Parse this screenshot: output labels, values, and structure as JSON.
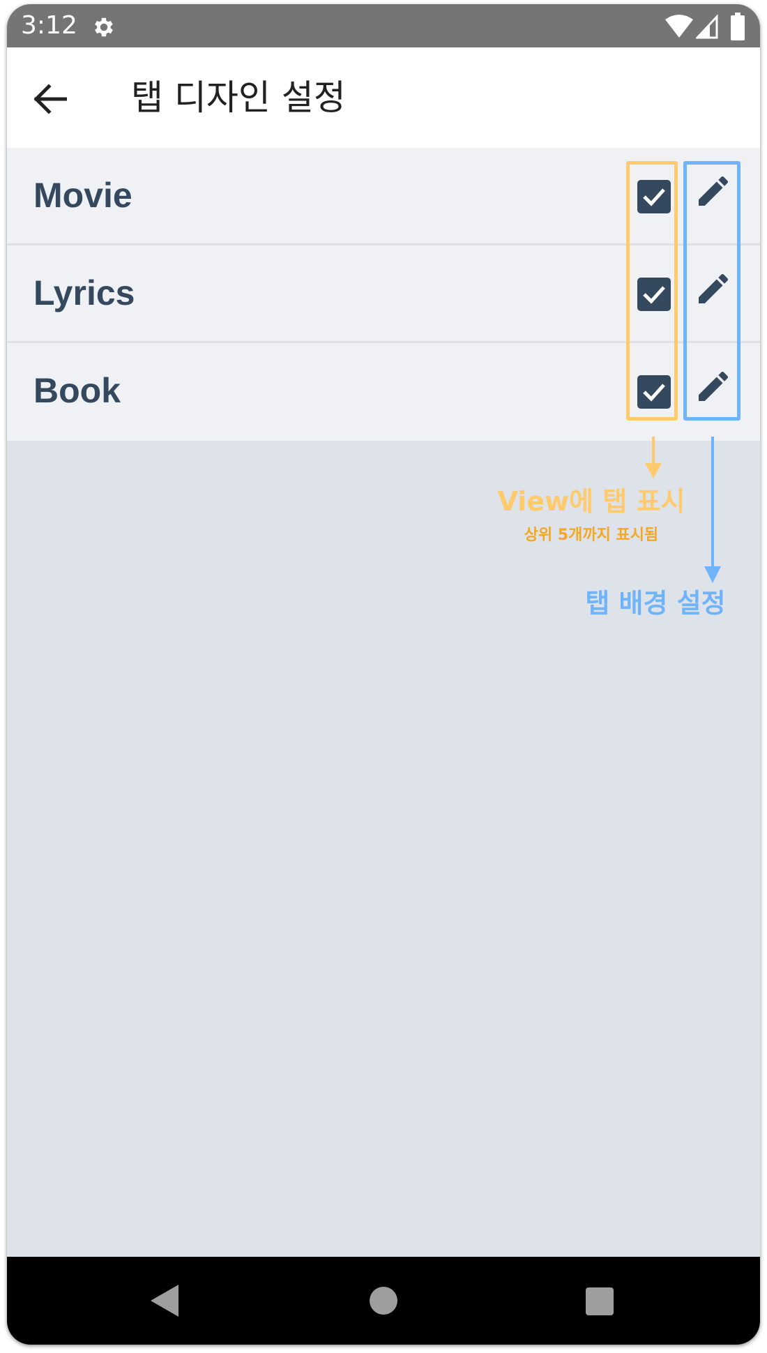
{
  "status_bar": {
    "time": "3:12"
  },
  "app_bar": {
    "title": "탭 디자인 설정"
  },
  "tabs": [
    {
      "label": "Movie",
      "checked": true
    },
    {
      "label": "Lyrics",
      "checked": true
    },
    {
      "label": "Book",
      "checked": true
    }
  ],
  "annotations": {
    "view_toggle": {
      "title": "View에 탭 표시",
      "subtitle": "상위 5개까지 표시됨",
      "color": "#ffca6b"
    },
    "background_edit": {
      "title": "탭 배경 설정",
      "color": "#6fb4fa"
    }
  },
  "colors": {
    "row_background": "#eff1f5",
    "page_background": "#dde3e8",
    "label_text": "#34495e",
    "status_bar": "#757575"
  },
  "icons": {
    "status": [
      "gear-icon",
      "wifi-icon",
      "signal-icon",
      "battery-icon"
    ],
    "nav": [
      "nav-back-icon",
      "nav-home-icon",
      "nav-recents-icon"
    ]
  }
}
